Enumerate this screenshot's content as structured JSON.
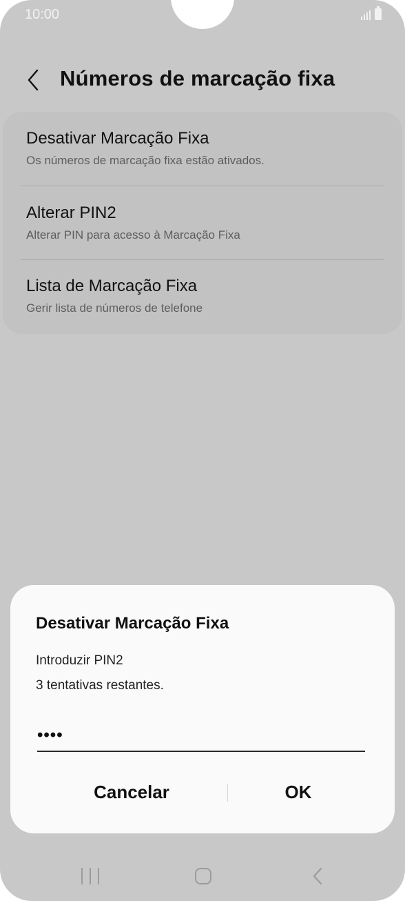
{
  "status_bar": {
    "time": "10:00"
  },
  "header": {
    "title": "Números de marcação fixa"
  },
  "settings": [
    {
      "title": "Desativar Marcação Fixa",
      "subtitle": "Os números de marcação fixa estão ativados."
    },
    {
      "title": "Alterar PIN2",
      "subtitle": "Alterar PIN para acesso à Marcação Fixa"
    },
    {
      "title": "Lista de Marcação Fixa",
      "subtitle": "Gerir lista de números de telefone"
    }
  ],
  "dialog": {
    "title": "Desativar Marcação Fixa",
    "message_line1": "Introduzir PIN2",
    "message_line2": "3 tentativas restantes.",
    "pin_value": "••••",
    "cancel_label": "Cancelar",
    "ok_label": "OK"
  },
  "icons": {
    "back": "back-chevron-icon",
    "signal": "signal-icon",
    "battery": "battery-icon",
    "nav_recents": "recents-icon",
    "nav_home": "home-icon",
    "nav_back": "nav-back-icon"
  }
}
